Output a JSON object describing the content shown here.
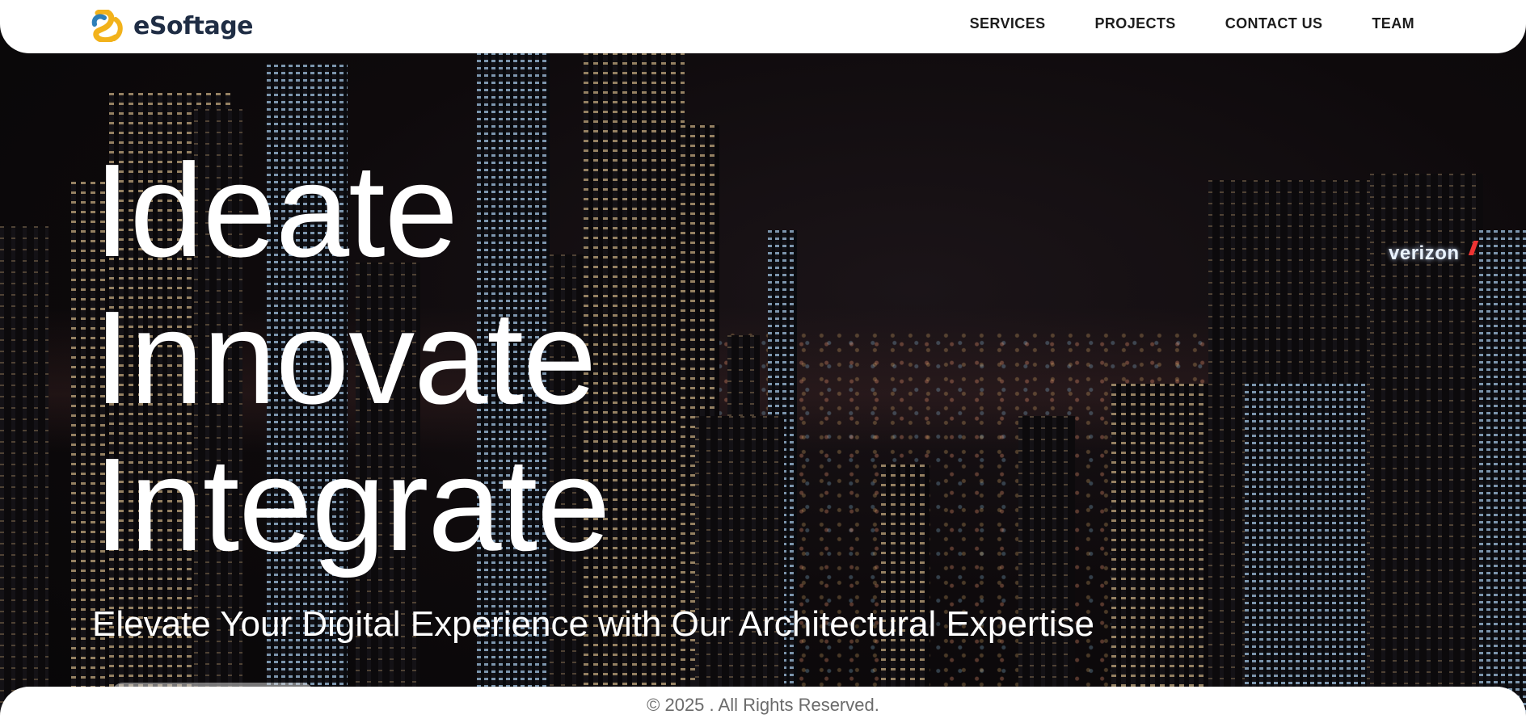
{
  "header": {
    "logo_text": "eSoftage",
    "logo_icon": "esoftage-logo-icon",
    "nav": [
      {
        "label": "SERVICES"
      },
      {
        "label": "PROJECTS"
      },
      {
        "label": "CONTACT US"
      },
      {
        "label": "TEAM"
      }
    ]
  },
  "hero": {
    "headline": [
      "Ideate",
      "Innovate",
      "Integrate"
    ],
    "tagline": "Elevate Your Digital Experience with Our Architectural Expertise",
    "background": "night-city-skyline-image",
    "sign_text": "verizon"
  },
  "footer": {
    "copyright": "© 2025 . All Rights Reserved."
  },
  "colors": {
    "header_bg": "#ffffff",
    "nav_text": "#1c1c1c",
    "logo_text": "#1f2d44",
    "logo_yellow": "#f2b21b",
    "logo_blue": "#2e7fb8",
    "hero_text": "#ffffff",
    "footer_text": "#6b6b6b"
  }
}
